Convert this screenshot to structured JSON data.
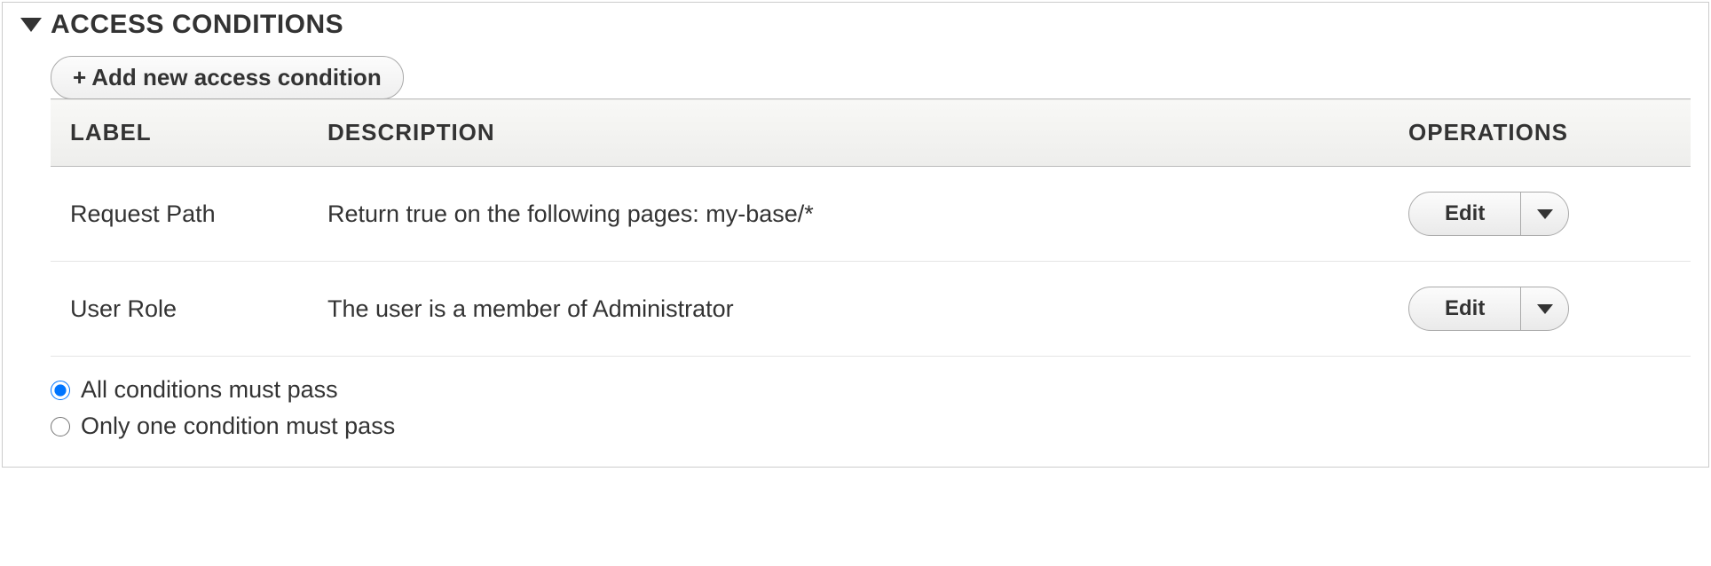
{
  "section": {
    "title": "ACCESS CONDITIONS",
    "add_button_label": "Add new access condition"
  },
  "table": {
    "headers": {
      "label": "LABEL",
      "description": "DESCRIPTION",
      "operations": "OPERATIONS"
    },
    "rows": [
      {
        "label": "Request Path",
        "description": "Return true on the following pages: my-base/*",
        "op_primary": "Edit"
      },
      {
        "label": "User Role",
        "description": "The user is a member of Administrator",
        "op_primary": "Edit"
      }
    ]
  },
  "logic": {
    "options": {
      "all": "All conditions must pass",
      "one": "Only one condition must pass"
    },
    "selected": "all"
  }
}
